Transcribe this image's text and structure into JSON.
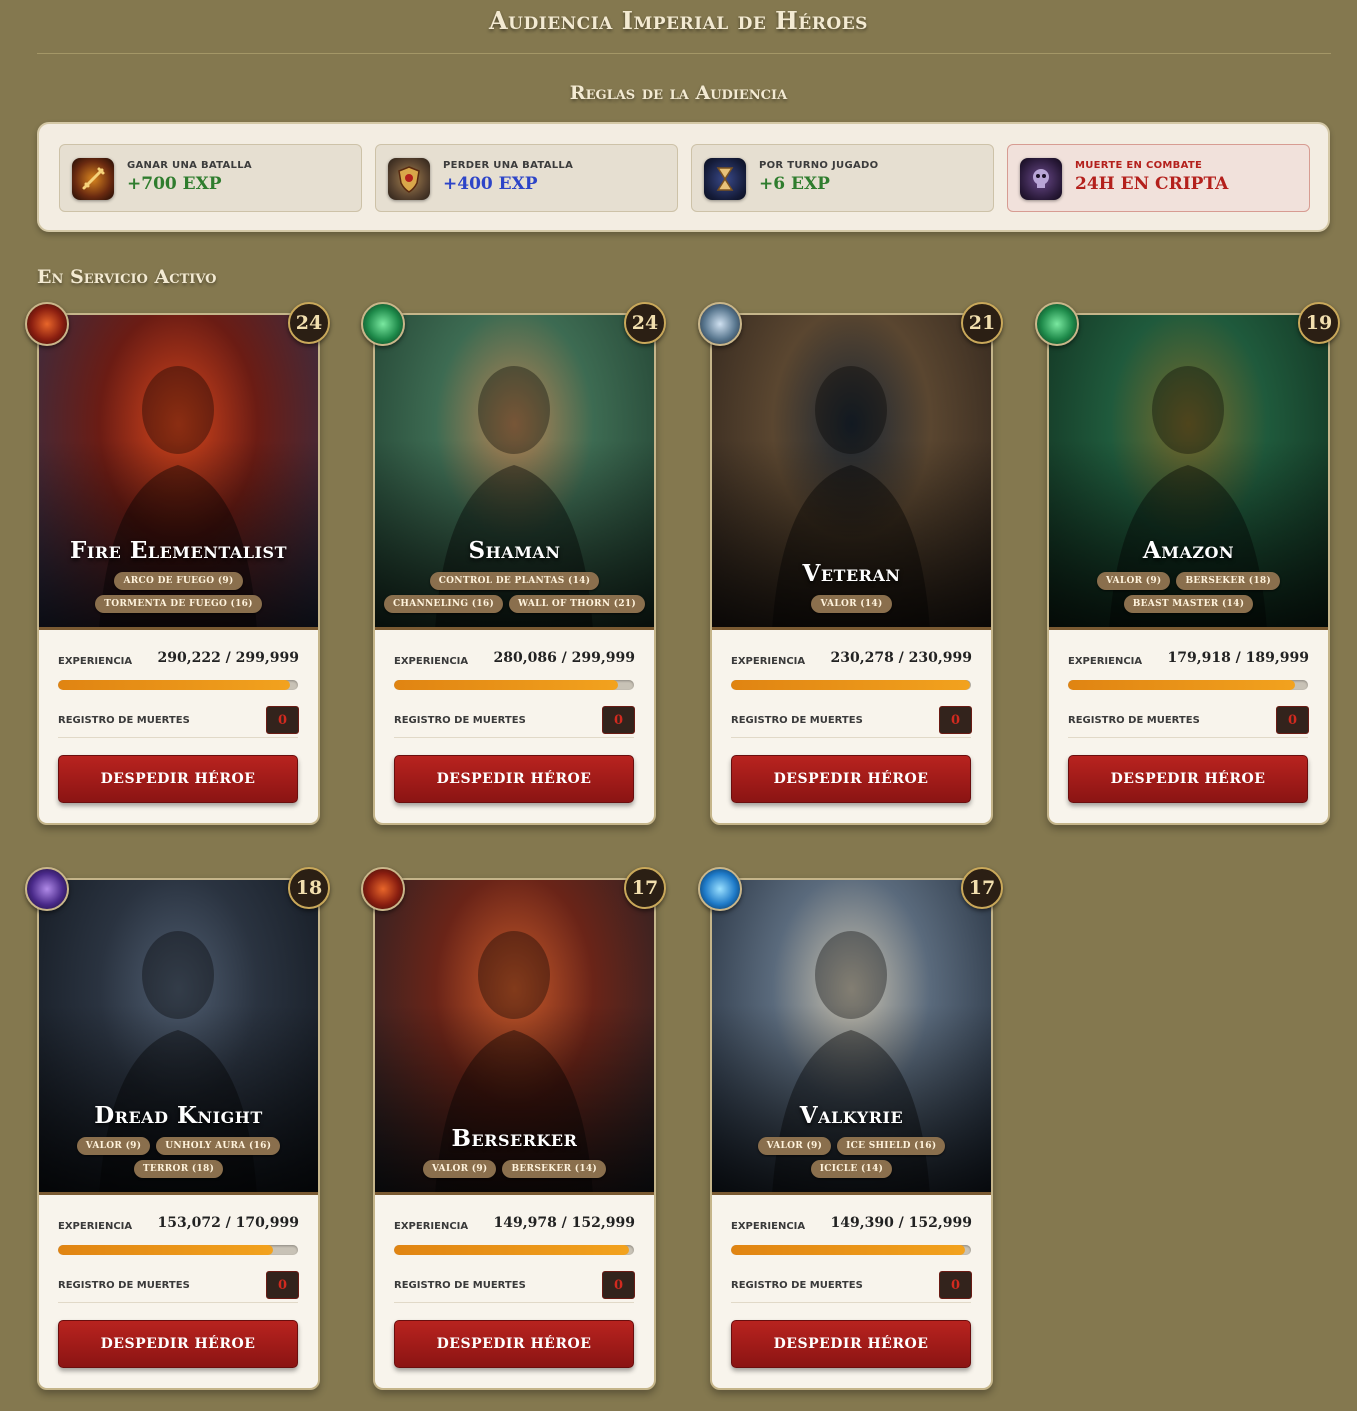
{
  "page": {
    "title": "Audiencia Imperial de Héroes",
    "rules_title": "Reglas de la Audiencia",
    "section_title": "En Servicio Activo"
  },
  "rules": [
    {
      "label": "GANAR UNA BATALLA",
      "value": "+700 EXP",
      "value_color": "#2f7d2e",
      "icon": "sword-icon",
      "danger": false
    },
    {
      "label": "PERDER UNA BATALLA",
      "value": "+400 EXP",
      "value_color": "#2c44c8",
      "icon": "shield-icon",
      "danger": false
    },
    {
      "label": "POR TURNO JUGADO",
      "value": "+6 EXP",
      "value_color": "#2f7d2e",
      "icon": "hourglass-icon",
      "danger": false
    },
    {
      "label": "MUERTE EN COMBATE",
      "value": "24H EN CRIPTA",
      "value_color": "#b4201c",
      "label_color": "#b4201c",
      "icon": "skull-icon",
      "danger": true
    }
  ],
  "labels": {
    "experience": "EXPERIENCIA",
    "deaths": "REGISTRO DE MUERTES",
    "dismiss": "DESPEDIR HÉROE"
  },
  "heroes": [
    {
      "name": "Fire Elementalist",
      "level": "24",
      "element": "fire-element-icon",
      "skills": [
        "ARCO DE FUEGO (9)",
        "TORMENTA DE FUEGO (16)"
      ],
      "exp_current": 290222,
      "exp_max": 299999,
      "exp_text": "290,222 / 299,999",
      "deaths": "0",
      "palette": [
        "#2a3350",
        "#6b1c14",
        "#d6461c"
      ]
    },
    {
      "name": "Shaman",
      "level": "24",
      "element": "nature-element-icon",
      "skills": [
        "CONTROL DE PLANTAS (14)",
        "CHANNELING (16)",
        "WALL OF THORN (21)"
      ],
      "exp_current": 280086,
      "exp_max": 299999,
      "exp_text": "280,086 / 299,999",
      "deaths": "0",
      "palette": [
        "#1d3a2c",
        "#3d6b52",
        "#b88455"
      ]
    },
    {
      "name": "Veteran",
      "level": "21",
      "element": "steel-element-icon",
      "skills": [
        "VALOR (14)"
      ],
      "exp_current": 230278,
      "exp_max": 230999,
      "exp_text": "230,278 / 230,999",
      "deaths": "0",
      "palette": [
        "#2a201a",
        "#5a4630",
        "#1c2733"
      ]
    },
    {
      "name": "Amazon",
      "level": "19",
      "element": "nature-element-icon",
      "skills": [
        "VALOR (9)",
        "BERSEKER (18)",
        "BEAST MASTER (14)"
      ],
      "exp_current": 179918,
      "exp_max": 189999,
      "exp_text": "179,918 / 189,999",
      "deaths": "0",
      "palette": [
        "#102a1c",
        "#1f5a3c",
        "#7a6a2c"
      ]
    },
    {
      "name": "Dread Knight",
      "level": "18",
      "element": "shadow-element-icon",
      "skills": [
        "VALOR (9)",
        "UNHOLY AURA (16)",
        "TERROR (18)"
      ],
      "exp_current": 153072,
      "exp_max": 170999,
      "exp_text": "153,072 / 170,999",
      "deaths": "0",
      "palette": [
        "#10151c",
        "#2a3340",
        "#4f5d70"
      ]
    },
    {
      "name": "Berserker",
      "level": "17",
      "element": "fire-element-icon",
      "skills": [
        "VALOR (9)",
        "BERSEKER (14)"
      ],
      "exp_current": 149978,
      "exp_max": 152999,
      "exp_text": "149,978 / 152,999",
      "deaths": "0",
      "palette": [
        "#1e2228",
        "#6a2418",
        "#c85a2a"
      ]
    },
    {
      "name": "Valkyrie",
      "level": "17",
      "element": "ice-element-icon",
      "skills": [
        "VALOR (9)",
        "ICE SHIELD (16)",
        "ICICLE (14)"
      ],
      "exp_current": 149390,
      "exp_max": 152999,
      "exp_text": "149,390 / 152,999",
      "deaths": "0",
      "palette": [
        "#1c2634",
        "#5a6a7c",
        "#c9c2b0"
      ]
    }
  ]
}
